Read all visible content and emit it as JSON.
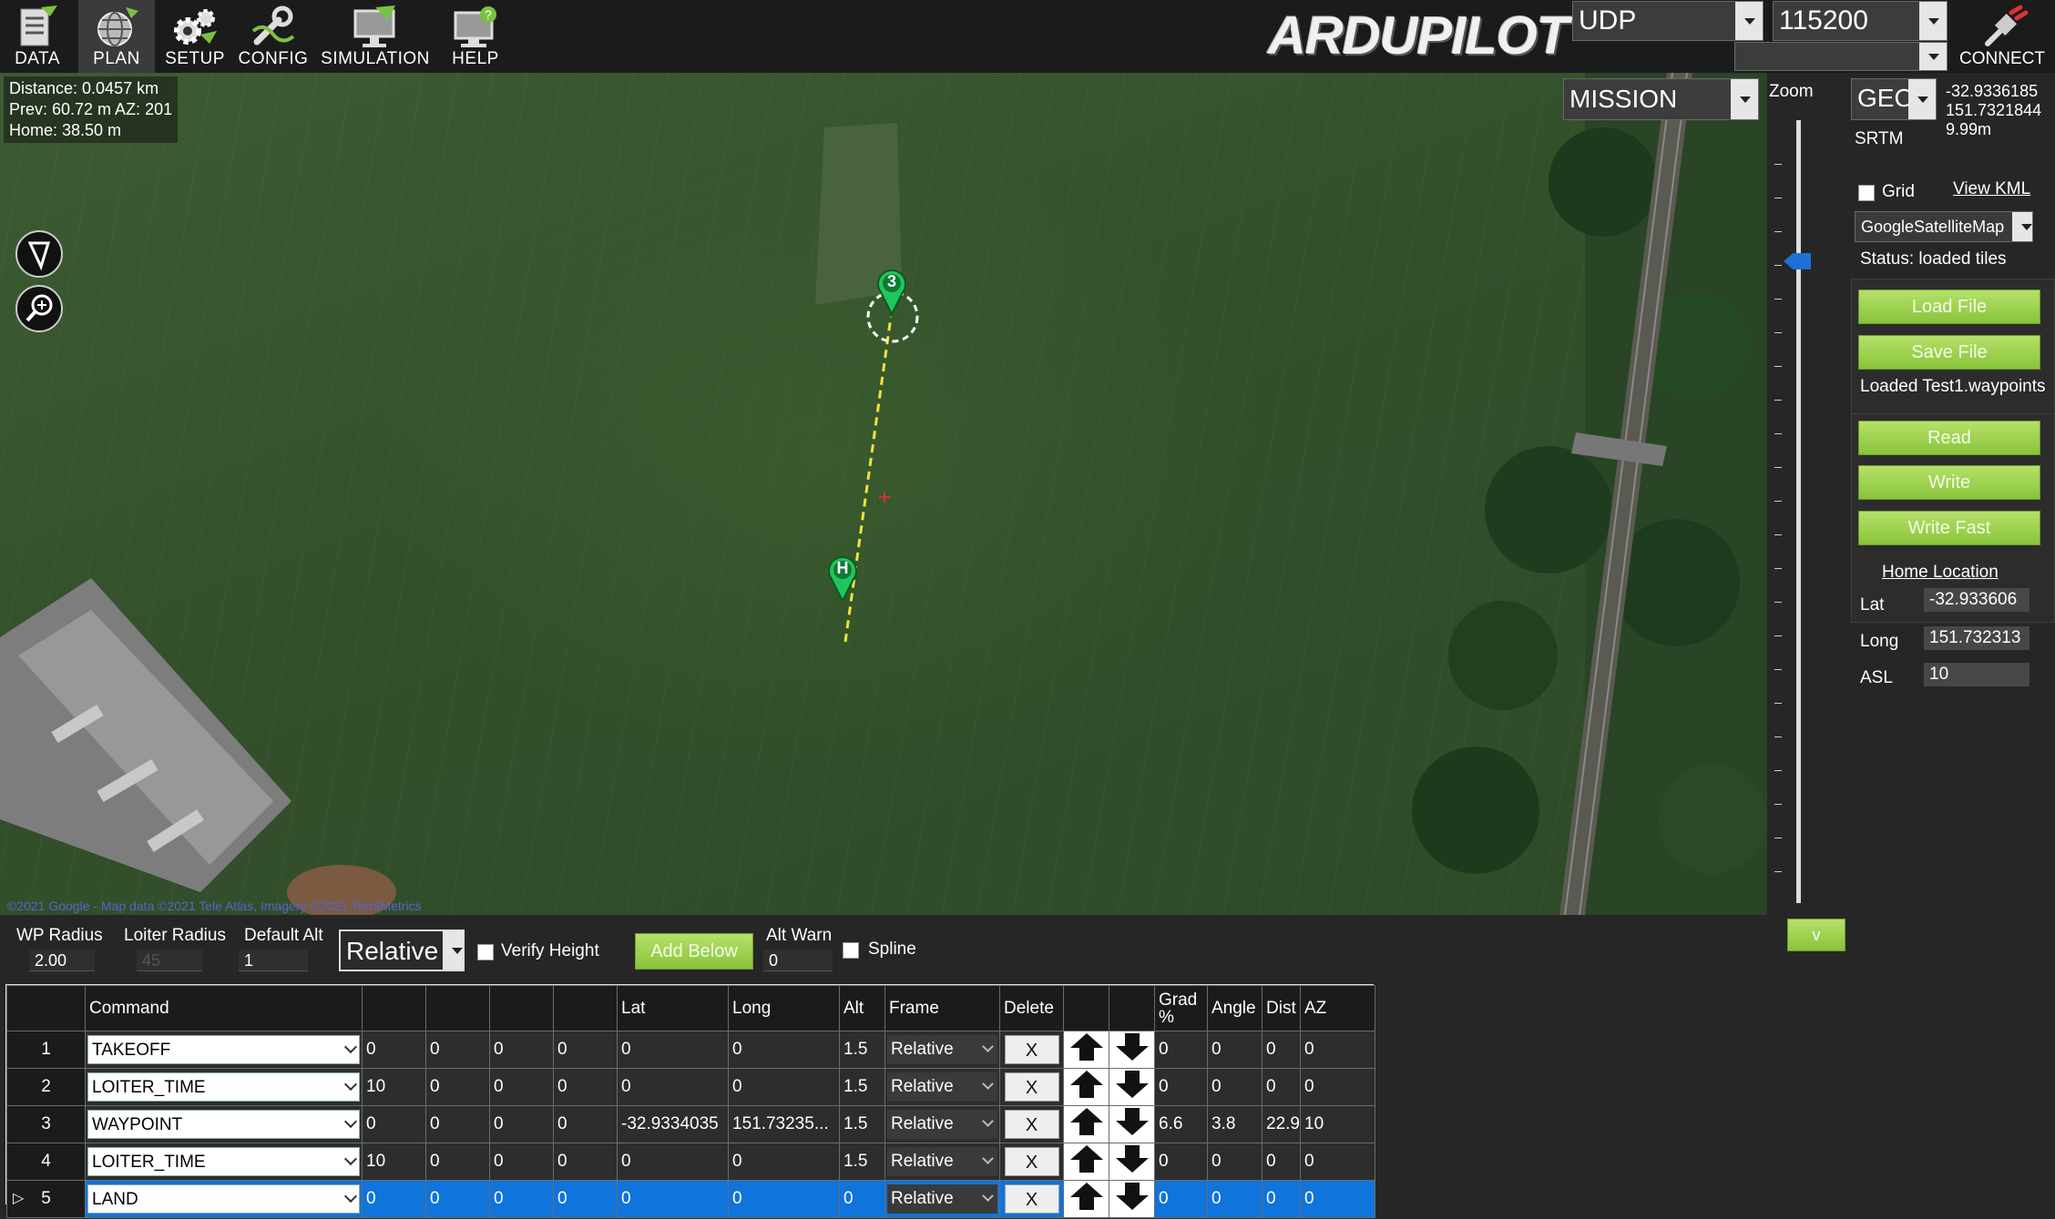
{
  "toolbar": {
    "items": [
      {
        "label": "DATA",
        "icon": "data-icon"
      },
      {
        "label": "PLAN",
        "icon": "plan-icon",
        "active": true
      },
      {
        "label": "SETUP",
        "icon": "setup-icon"
      },
      {
        "label": "CONFIG",
        "icon": "config-icon"
      },
      {
        "label": "SIMULATION",
        "icon": "simulation-icon"
      },
      {
        "label": "HELP",
        "icon": "help-icon"
      }
    ],
    "brand": "ARDUPILOT",
    "connection_type": "UDP",
    "baud_rate": "115200",
    "connect_label": "CONNECT"
  },
  "map": {
    "distance": "Distance: 0.0457 km",
    "prev": "Prev: 60.72 m AZ: 201",
    "home": "Home: 38.50 m",
    "mode": "MISSION",
    "waypoint_marker": "3",
    "home_marker": "H",
    "attribution": "©2021 Google - Map data ©2021 Tele Atlas, Imagery ©2021 TerraMetrics"
  },
  "zoom": {
    "label": "Zoom"
  },
  "right_panel": {
    "coord_system": "GEO",
    "cursor_lat": "-32.9336185",
    "cursor_lng": "151.7321844",
    "cursor_alt": "9.99m",
    "srtm": "SRTM",
    "grid_label": "Grid",
    "view_kml": "View KML",
    "map_provider": "GoogleSatelliteMap",
    "status": "Status: loaded tiles",
    "load_file": "Load File",
    "save_file": "Save File",
    "loaded_file": "Loaded Test1.waypoints",
    "read": "Read",
    "write": "Write",
    "write_fast": "Write Fast",
    "home_location": "Home Location",
    "home_lat_label": "Lat",
    "home_lat": "-32.933606",
    "home_lng_label": "Long",
    "home_lng": "151.732313",
    "home_asl_label": "ASL",
    "home_asl": "10",
    "v_button": "v"
  },
  "options": {
    "wp_radius_label": "WP Radius",
    "wp_radius": "2.00",
    "loiter_radius_label": "Loiter Radius",
    "loiter_radius": "45",
    "default_alt_label": "Default Alt",
    "default_alt": "1",
    "alt_frame": "Relative",
    "verify_height": "Verify Height",
    "add_below": "Add Below",
    "alt_warn_label": "Alt Warn",
    "alt_warn": "0",
    "spline": "Spline"
  },
  "table": {
    "headers": [
      "",
      "Command",
      "",
      "",
      "",
      "",
      "Lat",
      "Long",
      "Alt",
      "Frame",
      "Delete",
      "",
      "",
      "Grad %",
      "Angle",
      "Dist",
      "AZ"
    ],
    "rows": [
      {
        "num": "1",
        "command": "TAKEOFF",
        "p1": "0",
        "p2": "0",
        "p3": "0",
        "p4": "0",
        "lat": "0",
        "lng": "0",
        "alt": "1.5",
        "frame": "Relative",
        "delete": "X",
        "grad": "0",
        "angle": "0",
        "dist": "0",
        "az": "0"
      },
      {
        "num": "2",
        "command": "LOITER_TIME",
        "p1": "10",
        "p2": "0",
        "p3": "0",
        "p4": "0",
        "lat": "0",
        "lng": "0",
        "alt": "1.5",
        "frame": "Relative",
        "delete": "X",
        "grad": "0",
        "angle": "0",
        "dist": "0",
        "az": "0"
      },
      {
        "num": "3",
        "command": "WAYPOINT",
        "p1": "0",
        "p2": "0",
        "p3": "0",
        "p4": "0",
        "lat": "-32.9334035",
        "lng": "151.73235...",
        "alt": "1.5",
        "frame": "Relative",
        "delete": "X",
        "grad": "6.6",
        "angle": "3.8",
        "dist": "22.9",
        "az": "10"
      },
      {
        "num": "4",
        "command": "LOITER_TIME",
        "p1": "10",
        "p2": "0",
        "p3": "0",
        "p4": "0",
        "lat": "0",
        "lng": "0",
        "alt": "1.5",
        "frame": "Relative",
        "delete": "X",
        "grad": "0",
        "angle": "0",
        "dist": "0",
        "az": "0"
      },
      {
        "num": "5",
        "command": "LAND",
        "p1": "0",
        "p2": "0",
        "p3": "0",
        "p4": "0",
        "lat": "0",
        "lng": "0",
        "alt": "0",
        "frame": "Relative",
        "delete": "X",
        "grad": "0",
        "angle": "0",
        "dist": "0",
        "az": "0",
        "selected": true
      }
    ]
  },
  "colors": {
    "accent_green": "#89c43a",
    "selection_blue": "#0f74dc",
    "waypoint_green": "#22c55e",
    "path_yellow": "#f2e23a"
  }
}
